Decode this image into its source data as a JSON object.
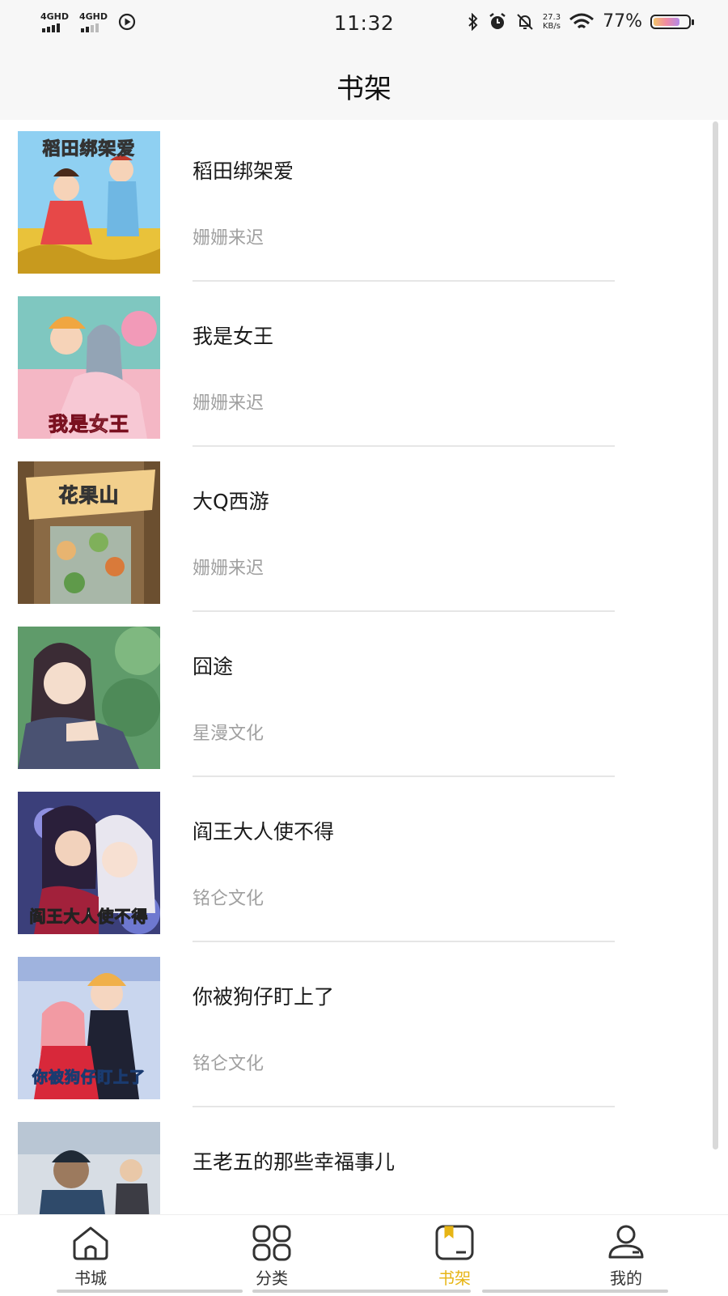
{
  "status_bar": {
    "sim1": "4GHD",
    "sim2": "4GHD",
    "time": "11:32",
    "speed_value": "27.3",
    "speed_unit": "KB/s",
    "battery_percent": "77%",
    "battery_level": 0.77
  },
  "header": {
    "title": "书架"
  },
  "books": [
    {
      "title": "稻田绑架爱",
      "author": "姗姗来迟",
      "cover_text": "稻田绑架爱"
    },
    {
      "title": "我是女王",
      "author": "姗姗来迟",
      "cover_text": "我是女王"
    },
    {
      "title": "大Q西游",
      "author": "姗姗来迟",
      "cover_text": "花果山"
    },
    {
      "title": "囧途",
      "author": "星漫文化",
      "cover_text": ""
    },
    {
      "title": "阎王大人使不得",
      "author": "铭仑文化",
      "cover_text": "阎王大人使不得"
    },
    {
      "title": "你被狗仔盯上了",
      "author": "铭仑文化",
      "cover_text": "你被狗仔盯上了"
    },
    {
      "title": "王老五的那些幸福事儿",
      "author": "",
      "cover_text": ""
    }
  ],
  "bottom_nav": {
    "items": [
      {
        "label": "书城",
        "icon": "home-icon"
      },
      {
        "label": "分类",
        "icon": "grid-icon"
      },
      {
        "label": "书架",
        "icon": "bookshelf-icon"
      },
      {
        "label": "我的",
        "icon": "user-icon"
      }
    ],
    "active_index": 2,
    "active_color": "#E7B515"
  }
}
